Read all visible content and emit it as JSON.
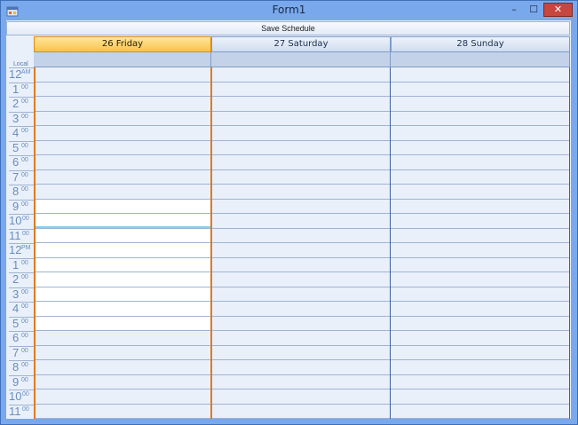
{
  "window": {
    "title": "Form1",
    "icons": {
      "app": "app-icon",
      "minimize": "minimize-icon",
      "maximize": "maximize-icon",
      "close": "close-icon"
    },
    "minimize_glyph": "–",
    "maximize_glyph": "☐",
    "close_glyph": "✕"
  },
  "toolbar": {
    "save_label": "Save Schedule"
  },
  "scheduler": {
    "timezone_label": "Local",
    "days": [
      {
        "label": "26 Friday",
        "today": true
      },
      {
        "label": "27 Saturday",
        "today": false
      },
      {
        "label": "28 Sunday",
        "today": false
      }
    ],
    "hours": [
      {
        "num": "12",
        "sup": "AM",
        "work": false
      },
      {
        "num": "1",
        "sup": "00",
        "work": false
      },
      {
        "num": "2",
        "sup": "00",
        "work": false
      },
      {
        "num": "3",
        "sup": "00",
        "work": false
      },
      {
        "num": "4",
        "sup": "00",
        "work": false
      },
      {
        "num": "5",
        "sup": "00",
        "work": false
      },
      {
        "num": "6",
        "sup": "00",
        "work": false
      },
      {
        "num": "7",
        "sup": "00",
        "work": false
      },
      {
        "num": "8",
        "sup": "00",
        "work": false
      },
      {
        "num": "9",
        "sup": "00",
        "work": true
      },
      {
        "num": "10",
        "sup": "00",
        "work": true
      },
      {
        "num": "11",
        "sup": "00",
        "work": true
      },
      {
        "num": "12",
        "sup": "PM",
        "work": true
      },
      {
        "num": "1",
        "sup": "00",
        "work": true
      },
      {
        "num": "2",
        "sup": "00",
        "work": true
      },
      {
        "num": "3",
        "sup": "00",
        "work": true
      },
      {
        "num": "4",
        "sup": "00",
        "work": true
      },
      {
        "num": "5",
        "sup": "00",
        "work": true
      },
      {
        "num": "6",
        "sup": "00",
        "work": false
      },
      {
        "num": "7",
        "sup": "00",
        "work": false
      },
      {
        "num": "8",
        "sup": "00",
        "work": false
      },
      {
        "num": "9",
        "sup": "00",
        "work": false
      },
      {
        "num": "10",
        "sup": "00",
        "work": false
      },
      {
        "num": "11",
        "sup": "00",
        "work": false
      }
    ]
  },
  "colors": {
    "today_header": "#f9c24c",
    "today_border": "#e07a1f",
    "day_border": "#3d5f99",
    "work_slot": "#ffffff",
    "off_slot": "#e9f0fa",
    "current_time": "#7fd0f0"
  }
}
